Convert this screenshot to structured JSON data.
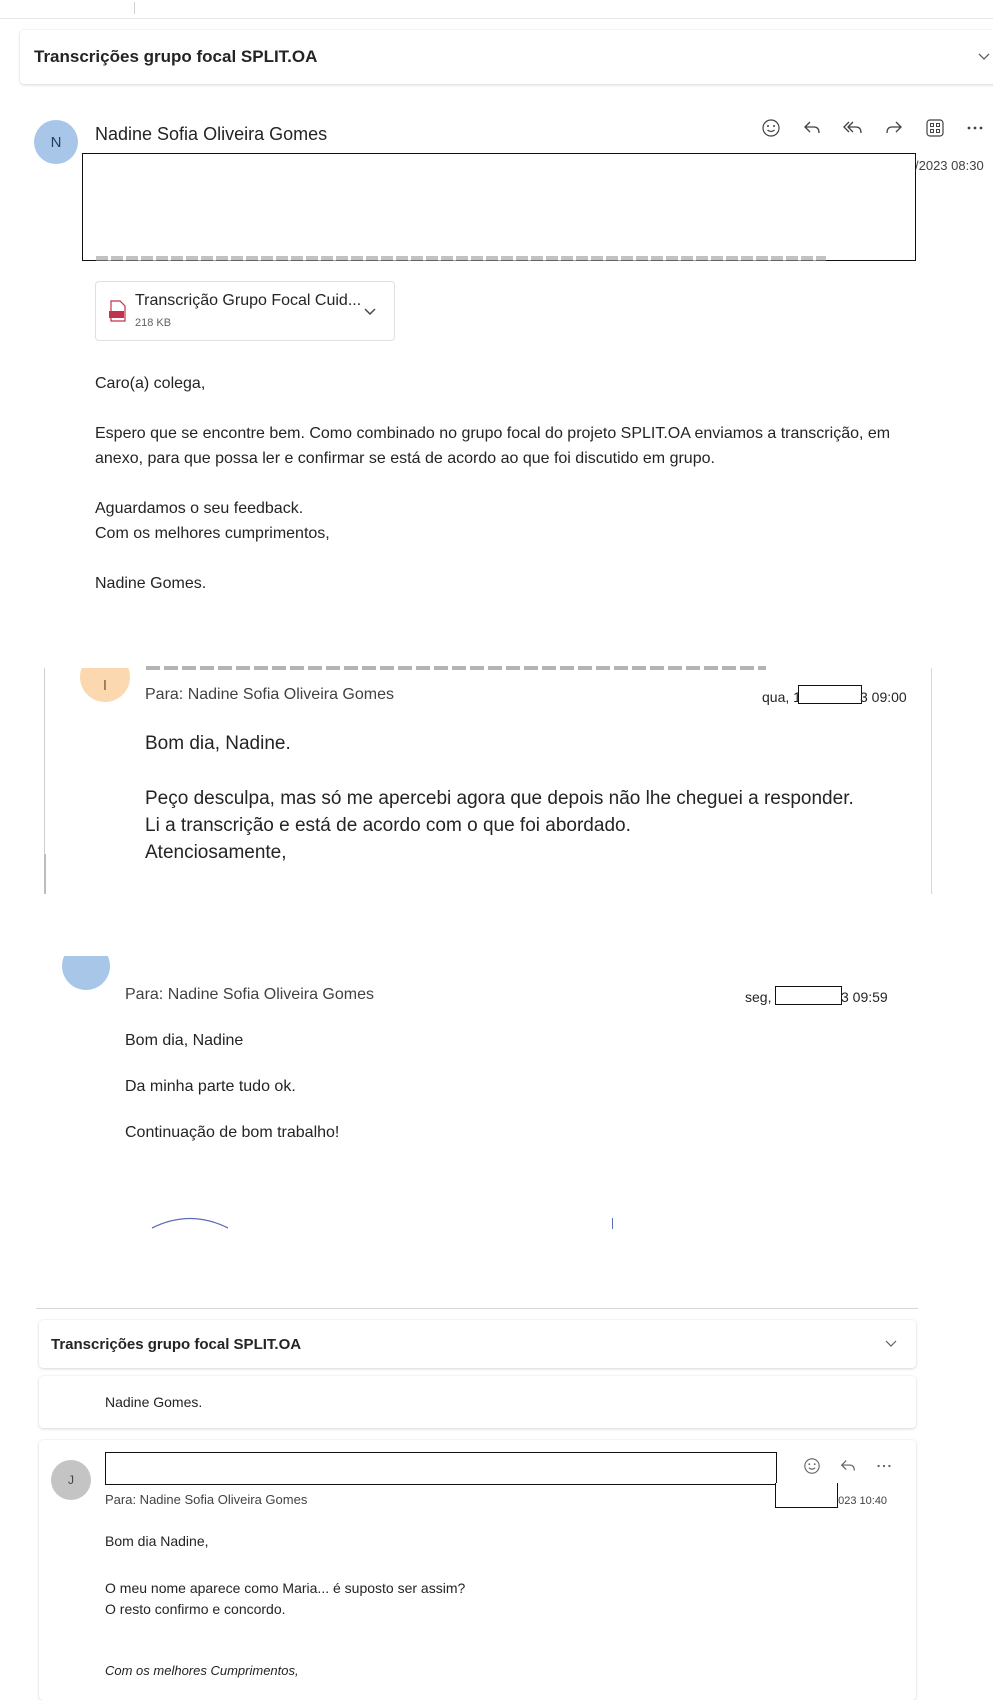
{
  "section1": {
    "subject": "Transcrições grupo focal SPLIT.OA",
    "sender_initial": "N",
    "sender_name": "Nadine Sofia Oliveira Gomes",
    "date_fragment": "/2023 08:30",
    "attachment": {
      "name": "Transcrição Grupo Focal Cuid...",
      "size": "218 KB"
    },
    "body": [
      "Caro(a) colega,",
      "Espero que se encontre bem. Como combinado no grupo focal do projeto SPLIT.OA enviamos a transcrição, em",
      "anexo, para que possa ler e confirmar se está de acordo ao que foi discutido em grupo.",
      "Aguardamos o seu feedback.",
      "Com os melhores cumprimentos,",
      "Nadine Gomes."
    ]
  },
  "section2": {
    "sender_initial": "I",
    "to_line": "Para:  Nadine Sofia Oliveira Gomes",
    "date_prefix": "qua, 1",
    "date_suffix": "3 09:00",
    "body": [
      "Bom dia, Nadine.",
      "Peço desculpa, mas só me apercebi agora que depois não lhe cheguei a responder.",
      "Li a transcrição e está de acordo com o que foi abordado.",
      "Atenciosamente,"
    ]
  },
  "section3": {
    "to_line": "Para:  Nadine Sofia Oliveira Gomes",
    "date_prefix": "seg,",
    "date_suffix": "3 09:59",
    "body": [
      "Bom dia, Nadine",
      "Da minha parte tudo ok.",
      "Continuação de bom trabalho!"
    ]
  },
  "section4": {
    "subject": "Transcrições grupo focal SPLIT.OA",
    "prev_signature": "Nadine Gomes.",
    "sender_initial": "J",
    "to_line": "Para:  Nadine Sofia Oliveira Gomes",
    "date_suffix": "2023 10:40",
    "body": [
      "Bom dia Nadine,",
      "O meu nome aparece como Maria... é suposto ser assim?",
      "O resto confirmo e concordo.",
      "Com os melhores Cumprimentos,"
    ]
  },
  "icons": [
    "smile-icon",
    "reply-icon",
    "reply-all-icon",
    "forward-icon",
    "apps-icon",
    "more-icon",
    "chevron-down-icon",
    "pdf-icon"
  ],
  "colors": {
    "avatar_blue": "#a8c7e8",
    "avatar_peach": "#fbd8b0",
    "avatar_grey": "#c4c4c4",
    "card_border": "#e1e1e1"
  }
}
